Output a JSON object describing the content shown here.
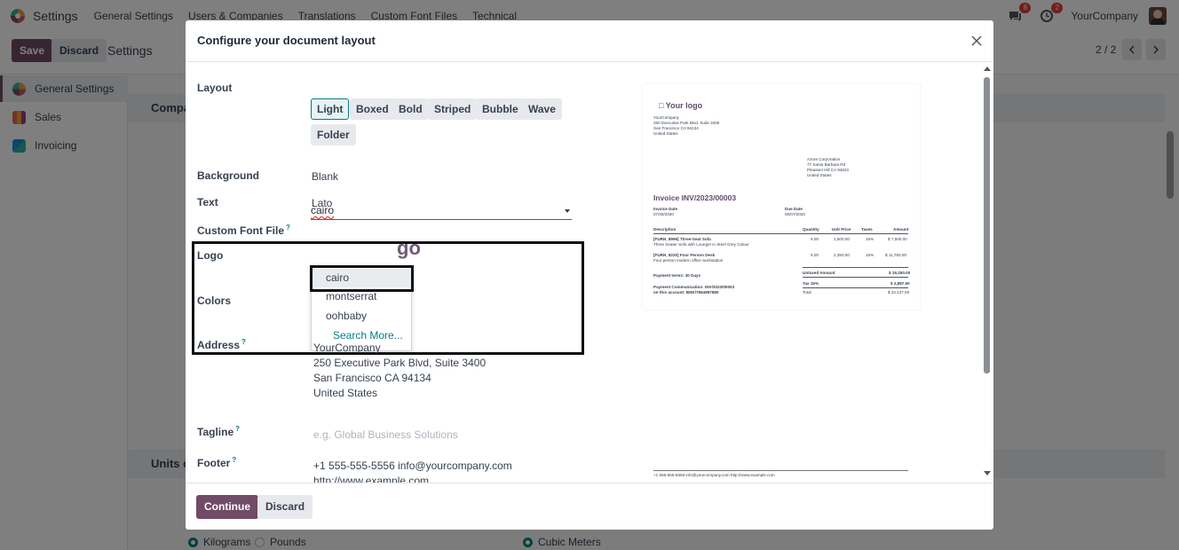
{
  "topbar": {
    "app_name": "Settings",
    "menu": [
      "General Settings",
      "Users & Companies",
      "Translations",
      "Custom Font Files",
      "Technical"
    ],
    "chat_badge": "8",
    "activity_badge": "2",
    "company": "YourCompany"
  },
  "controlbar": {
    "save_label": "Save",
    "discard_label": "Discard",
    "title": "Settings",
    "pager": "2 / 2"
  },
  "sidebar": {
    "items": [
      {
        "label": "General Settings",
        "color": "#714b67"
      },
      {
        "label": "Sales",
        "color": "#e46a46"
      },
      {
        "label": "Invoicing",
        "color": "#1a8fd3"
      }
    ]
  },
  "background": {
    "section1": "Compa",
    "section2": "Units o",
    "radio_kg": "Kilograms",
    "radio_lb": "Pounds",
    "radio_cm": "Cubic Meters"
  },
  "modal": {
    "title": "Configure your document layout",
    "fields": {
      "layout_label": "Layout",
      "layout_options": [
        "Light",
        "Boxed",
        "Bold",
        "Striped",
        "Bubble",
        "Wave",
        "Folder"
      ],
      "layout_selected": "Light",
      "background_label": "Background",
      "background_value": "Blank",
      "text_label": "Text",
      "text_value": "Lato",
      "custom_font_label": "Custom Font File",
      "custom_font_value": "cairo",
      "logo_label": "Logo",
      "logo_partial": "go",
      "colors_label": "Colors",
      "address_label": "Address",
      "address_lines": [
        "YourCompany",
        "250 Executive Park Blvd, Suite 3400",
        "San Francisco CA 94134",
        "United States"
      ],
      "tagline_label": "Tagline",
      "tagline_placeholder": "e.g. Global Business Solutions",
      "footer_label": "Footer",
      "footer_lines": [
        "+1 555-555-5556 info@yourcompany.com",
        "http://www.example.com"
      ]
    },
    "dropdown": {
      "options": [
        "cairo",
        "montserrat",
        "oohbaby"
      ],
      "search_more": "Search More..."
    },
    "buttons": {
      "continue": "Continue",
      "discard": "Discard"
    },
    "preview": {
      "logo": "Your logo",
      "company_block": [
        "YourCompany",
        "250 Executive Park Blvd, Suite 3400",
        "San Francisco CA 94134",
        "United States"
      ],
      "customer_block": [
        "Azure Corporation",
        "77 Santa Barbara Rd",
        "Pleasant Hill CA 94523",
        "United States"
      ],
      "invoice_title": "Invoice INV/2023/00003",
      "invoice_date_label": "Invoice Date",
      "invoice_date": "07/08/2020",
      "due_date_label": "Due Date",
      "due_date": "08/07/2020",
      "columns": [
        "Description",
        "Quantity",
        "Unit Price",
        "Taxes",
        "Amount"
      ],
      "rows": [
        {
          "desc1": "[FURN_8999] Three-Seat Sofa",
          "desc2": "Three Seater Sofa with Lounger in Steel Grey Colour",
          "qty": "5.00",
          "price": "1,500.00",
          "tax": "15%",
          "amount": "$ 7,500.00"
        },
        {
          "desc1": "[FURN_8220] Four Person Desk",
          "desc2": "Four person modern office workstation",
          "qty": "5.00",
          "price": "2,350.00",
          "tax": "15%",
          "amount": "$ 11,750.00"
        }
      ],
      "payment_terms": "Payment terms: 30 Days",
      "payment_comm": "Payment Communication: INV/2023/00003",
      "payment_account": "on this account: BNK/7854997880",
      "untaxed_label": "Untaxed Amount",
      "untaxed": "$ 19,250.00",
      "tax_label": "Tax 15%",
      "tax": "$ 2,887.50",
      "total_label": "Total",
      "total": "$ 22,137.50",
      "footer": "+1 555-555-5556 info@yourcompany.com http://www.example.com"
    }
  }
}
